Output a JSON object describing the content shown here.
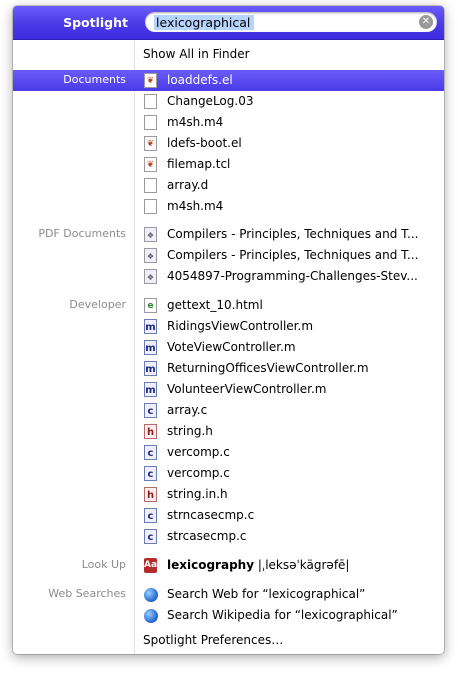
{
  "header": {
    "title": "Spotlight",
    "query": "lexicographical"
  },
  "show_all": "Show All in Finder",
  "categories": {
    "documents": "Documents",
    "pdf": "PDF Documents",
    "developer": "Developer",
    "lookup": "Look Up",
    "web": "Web Searches"
  },
  "documents": [
    {
      "label": "loaddefs.el",
      "icon": "el-file-icon"
    },
    {
      "label": "ChangeLog.03",
      "icon": "document-icon"
    },
    {
      "label": "m4sh.m4",
      "icon": "document-icon"
    },
    {
      "label": "ldefs-boot.el",
      "icon": "el-file-icon"
    },
    {
      "label": "filemap.tcl",
      "icon": "el-file-icon"
    },
    {
      "label": "array.d",
      "icon": "document-icon"
    },
    {
      "label": "m4sh.m4",
      "icon": "document-icon"
    }
  ],
  "pdf_documents": [
    {
      "label": "Compilers - Principles, Techniques and T...",
      "icon": "pdf-icon"
    },
    {
      "label": "Compilers - Principles, Techniques and T...",
      "icon": "pdf-icon"
    },
    {
      "label": "4054897-Programming-Challenges-Stev...",
      "icon": "pdf-icon"
    }
  ],
  "developer": [
    {
      "label": "gettext_10.html",
      "icon": "html-icon",
      "glyph": "e"
    },
    {
      "label": "RidingsViewController.m",
      "icon": "m-file-icon",
      "glyph": "m"
    },
    {
      "label": "VoteViewController.m",
      "icon": "m-file-icon",
      "glyph": "m"
    },
    {
      "label": "ReturningOfficesViewController.m",
      "icon": "m-file-icon",
      "glyph": "m"
    },
    {
      "label": "VolunteerViewController.m",
      "icon": "m-file-icon",
      "glyph": "m"
    },
    {
      "label": "array.c",
      "icon": "c-file-icon",
      "glyph": "c"
    },
    {
      "label": "string.h",
      "icon": "h-file-icon",
      "glyph": "h"
    },
    {
      "label": "vercomp.c",
      "icon": "c-file-icon",
      "glyph": "c"
    },
    {
      "label": "vercomp.c",
      "icon": "c-file-icon",
      "glyph": "c"
    },
    {
      "label": "string.in.h",
      "icon": "h-file-icon",
      "glyph": "h"
    },
    {
      "label": "strncasecmp.c",
      "icon": "c-file-icon",
      "glyph": "c"
    },
    {
      "label": "strcasecmp.c",
      "icon": "c-file-icon",
      "glyph": "c"
    }
  ],
  "lookup": {
    "word": "lexicography",
    "pronunciation": " |ˌleksəˈkägrəfē|",
    "icon": "dictionary-icon"
  },
  "web_searches": [
    {
      "label": "Search Web for “lexicographical”",
      "icon": "globe-icon"
    },
    {
      "label": "Search Wikipedia for “lexicographical”",
      "icon": "globe-icon"
    }
  ],
  "preferences": "Spotlight Preferences…",
  "colors": {
    "selection": "#4a3ae8",
    "category_text": "#8c8c8c"
  }
}
